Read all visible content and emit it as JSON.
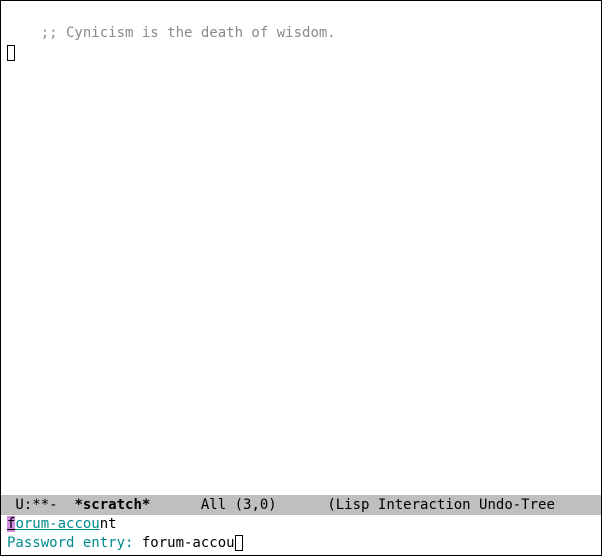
{
  "buffer": {
    "comment": ";; Cynicism is the death of wisdom."
  },
  "modeline": {
    "left": " U:**-  ",
    "buffer_name": "*scratch*",
    "gap1": "      ",
    "position": "All (3,0)",
    "gap2": "      ",
    "modes": "(Lisp Interaction Undo-Tree"
  },
  "minibuf": {
    "line1_first": "f",
    "line1_match": "orum-accou",
    "line1_rest": "nt",
    "prompt": "Password entry: ",
    "value": "forum-accou"
  }
}
